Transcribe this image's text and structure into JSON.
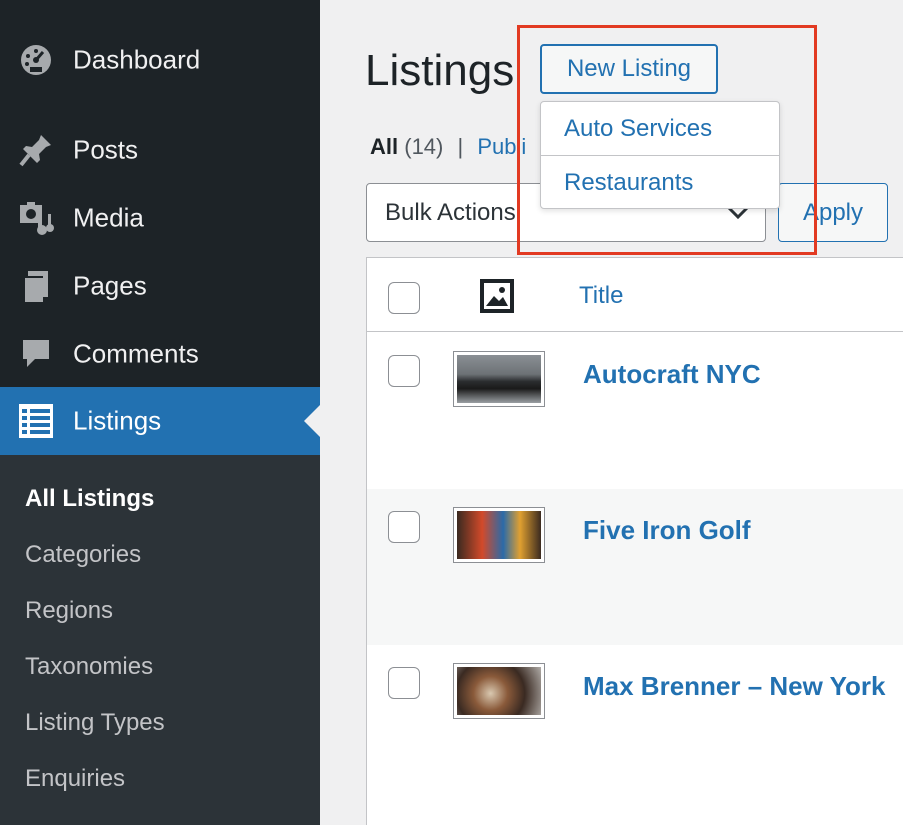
{
  "sidebar": {
    "menu": [
      {
        "label": "Dashboard",
        "icon": "dashboard-icon"
      },
      {
        "label": "Posts",
        "icon": "pin-icon"
      },
      {
        "label": "Media",
        "icon": "media-icon"
      },
      {
        "label": "Pages",
        "icon": "pages-icon"
      },
      {
        "label": "Comments",
        "icon": "comment-icon"
      },
      {
        "label": "Listings",
        "icon": "list-icon"
      }
    ],
    "submenu": [
      "All Listings",
      "Categories",
      "Regions",
      "Taxonomies",
      "Listing Types",
      "Enquiries"
    ]
  },
  "header": {
    "title": "Listings",
    "new_button": "New Listing"
  },
  "dropdown": {
    "items": [
      "Auto Services",
      "Restaurants"
    ]
  },
  "filters": {
    "all_label": "All",
    "all_count": "(14)",
    "separator": "|",
    "published_label": "Publi"
  },
  "bulk": {
    "select_value": "Bulk Actions",
    "apply_label": "Apply"
  },
  "table": {
    "columns": {
      "title": "Title"
    },
    "rows": [
      {
        "title": "Autocraft NYC"
      },
      {
        "title": "Five Iron Golf"
      },
      {
        "title": "Max Brenner – New York"
      }
    ]
  },
  "colors": {
    "sidebar_bg": "#1d2327",
    "accent": "#2271b1",
    "highlight": "#e23a22"
  }
}
